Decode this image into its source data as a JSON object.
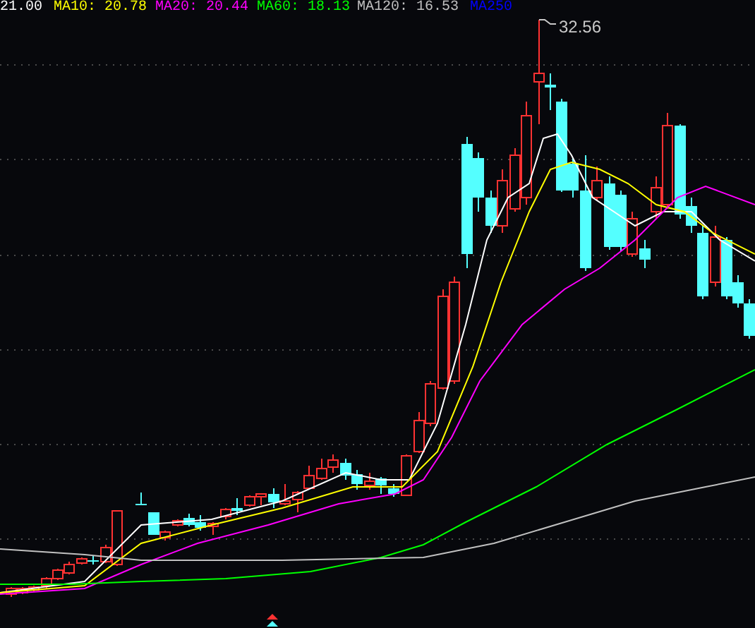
{
  "legend": [
    {
      "text": "21.00",
      "color": "#ffffff"
    },
    {
      "text": "MA10: 20.78",
      "color": "#ffff00"
    },
    {
      "text": "MA20: 20.44",
      "color": "#ff00ff"
    },
    {
      "text": "MA60: 18.13",
      "color": "#00ff00"
    },
    {
      "text": "MA120: 16.53",
      "color": "#c0c0c0"
    },
    {
      "text": "MA250",
      "color": "#0000ff"
    }
  ],
  "chart": {
    "peak_label": "32.56"
  }
}
